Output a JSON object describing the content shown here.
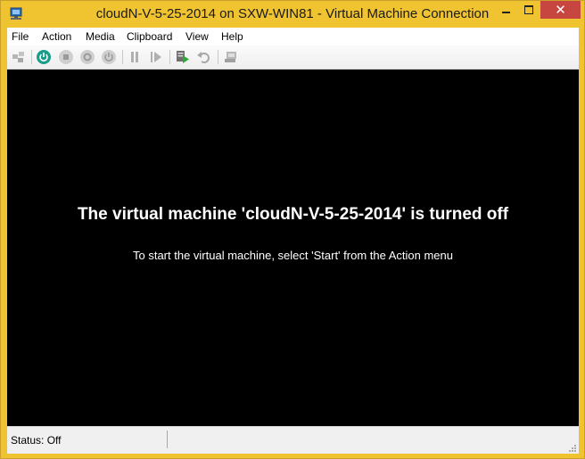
{
  "window": {
    "title": "cloudN-V-5-25-2014 on SXW-WIN81 - Virtual Machine Connection",
    "close_glyph": "✕"
  },
  "menu": {
    "items": [
      "File",
      "Action",
      "Media",
      "Clipboard",
      "View",
      "Help"
    ]
  },
  "toolbar": {
    "buttons": [
      {
        "icon": "ctrl-alt-del-icon",
        "enabled": false
      },
      {
        "icon": "start-icon",
        "enabled": true,
        "color": "#1a9e8a"
      },
      {
        "icon": "turn-off-icon",
        "enabled": false
      },
      {
        "icon": "shutdown-icon",
        "enabled": false
      },
      {
        "icon": "save-icon",
        "enabled": false
      },
      {
        "icon": "pause-icon",
        "enabled": false
      },
      {
        "icon": "resume-icon",
        "enabled": false
      },
      {
        "icon": "checkpoint-icon",
        "enabled": true
      },
      {
        "icon": "revert-icon",
        "enabled": false
      },
      {
        "icon": "enhanced-session-icon",
        "enabled": false
      }
    ]
  },
  "screen": {
    "title": "The virtual machine 'cloudN-V-5-25-2014' is turned off",
    "subtitle": "To start the virtual machine, select 'Start' from the Action menu"
  },
  "status": {
    "text": "Status: Off"
  },
  "colors": {
    "frame": "#f0c330",
    "close": "#c7463f",
    "screen": "#000000"
  }
}
